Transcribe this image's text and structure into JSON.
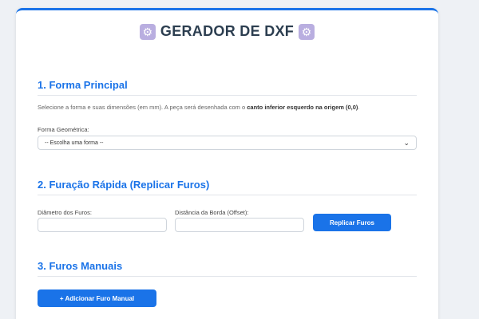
{
  "header": {
    "title": "GERADOR DE DXF"
  },
  "section1": {
    "title": "1. Forma Principal",
    "desc_prefix": "Selecione a forma e suas dimensões (em mm). A peça será desenhada com o",
    "desc_bold": "canto inferior esquerdo na origem (0,0)",
    "desc_suffix": ".",
    "shape_label": "Forma Geométrica:",
    "shape_selected": "-- Escolha uma forma --"
  },
  "section2": {
    "title": "2. Furação Rápida (Replicar Furos)",
    "diameter_label": "Diâmetro dos Furos:",
    "offset_label": "Distância da Borda (Offset):",
    "replicate_button": "Replicar Furos"
  },
  "section3": {
    "title": "3. Furos Manuais",
    "add_button": "+ Adicionar Furo Manual"
  },
  "colors": {
    "accent": "#1a73e8",
    "title": "#2c3e50"
  },
  "icons": {
    "title_left": "gear-icon",
    "title_right": "gear-icon",
    "select_arrow": "chevron-down-icon"
  }
}
